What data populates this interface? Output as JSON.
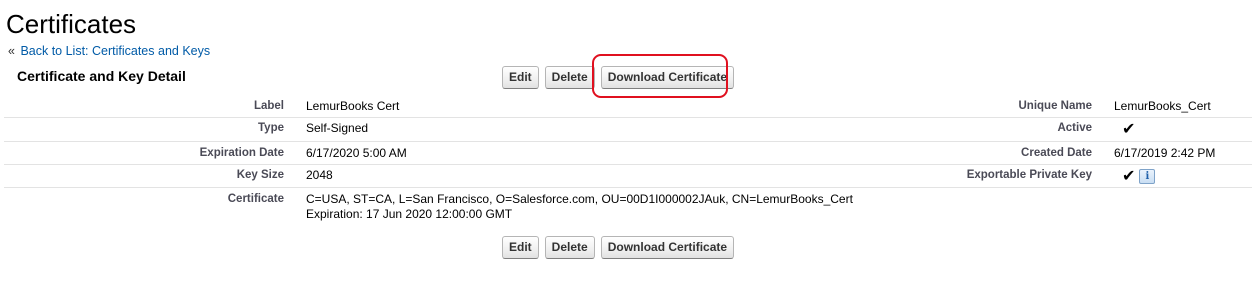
{
  "page": {
    "title": "Certificates",
    "back_link_prefix": "«",
    "back_link_label": "Back to List: Certificates and Keys"
  },
  "section": {
    "title": "Certificate and Key Detail"
  },
  "buttons": {
    "edit": "Edit",
    "delete": "Delete",
    "download": "Download Certificate"
  },
  "highlight": {
    "target": "Download Certificate",
    "color": "#e0101f"
  },
  "fields": {
    "label": {
      "label": "Label",
      "value": "LemurBooks Cert"
    },
    "unique_name": {
      "label": "Unique Name",
      "value": "LemurBooks_Cert"
    },
    "type": {
      "label": "Type",
      "value": "Self-Signed"
    },
    "active": {
      "label": "Active",
      "value": "✔",
      "checked": true
    },
    "expiration_date": {
      "label": "Expiration Date",
      "value": "6/17/2020 5:00 AM"
    },
    "created_date": {
      "label": "Created Date",
      "value": "6/17/2019 2:42 PM"
    },
    "key_size": {
      "label": "Key Size",
      "value": "2048"
    },
    "exportable_private_key": {
      "label": "Exportable Private Key",
      "value": "✔",
      "checked": true,
      "info_icon": "i"
    },
    "certificate": {
      "label": "Certificate",
      "line1": "C=USA, ST=CA, L=San Francisco, O=Salesforce.com, OU=00D1I000002JAuk, CN=LemurBooks_Cert",
      "line2": "Expiration: 17 Jun 2020 12:00:00 GMT"
    }
  },
  "colors": {
    "link": "#015ba7",
    "label_text": "#4a4a56",
    "row_divider": "#e3e3e3"
  },
  "icons": {
    "checkmark": "checkmark-icon",
    "info": "info-icon"
  }
}
